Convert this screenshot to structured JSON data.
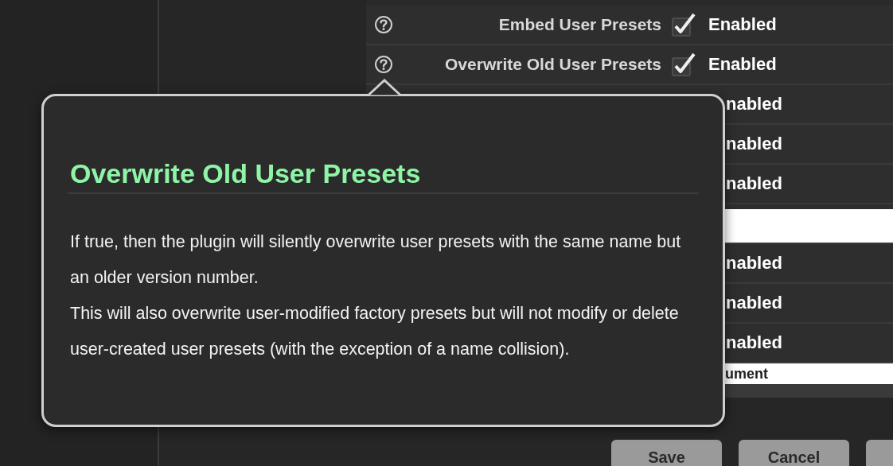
{
  "settings": {
    "rows": [
      {
        "kind": "toggle",
        "label": "Embed User Presets",
        "checked": true,
        "value": "Enabled"
      },
      {
        "kind": "toggle",
        "label": "Overwrite Old User Presets",
        "checked": true,
        "value": "Enabled"
      },
      {
        "kind": "toggle",
        "value": "nabled"
      },
      {
        "kind": "toggle",
        "value": "nabled"
      },
      {
        "kind": "toggle",
        "value": "nabled"
      },
      {
        "kind": "field"
      },
      {
        "kind": "toggle",
        "value": "nabled"
      },
      {
        "kind": "toggle",
        "value": "nabled"
      },
      {
        "kind": "toggle",
        "value": "nabled"
      },
      {
        "kind": "field",
        "value": "ument"
      }
    ]
  },
  "buttons": [
    "Save",
    "Cancel"
  ],
  "tooltip": {
    "title": "Overwrite Old User Presets",
    "paragraphs": [
      "If true, then the plugin will silently overwrite user presets with the same name but an older version number.",
      "This will also overwrite user-modified factory presets but will not modify or delete user-created user presets (with the exception of a name collision)."
    ]
  }
}
